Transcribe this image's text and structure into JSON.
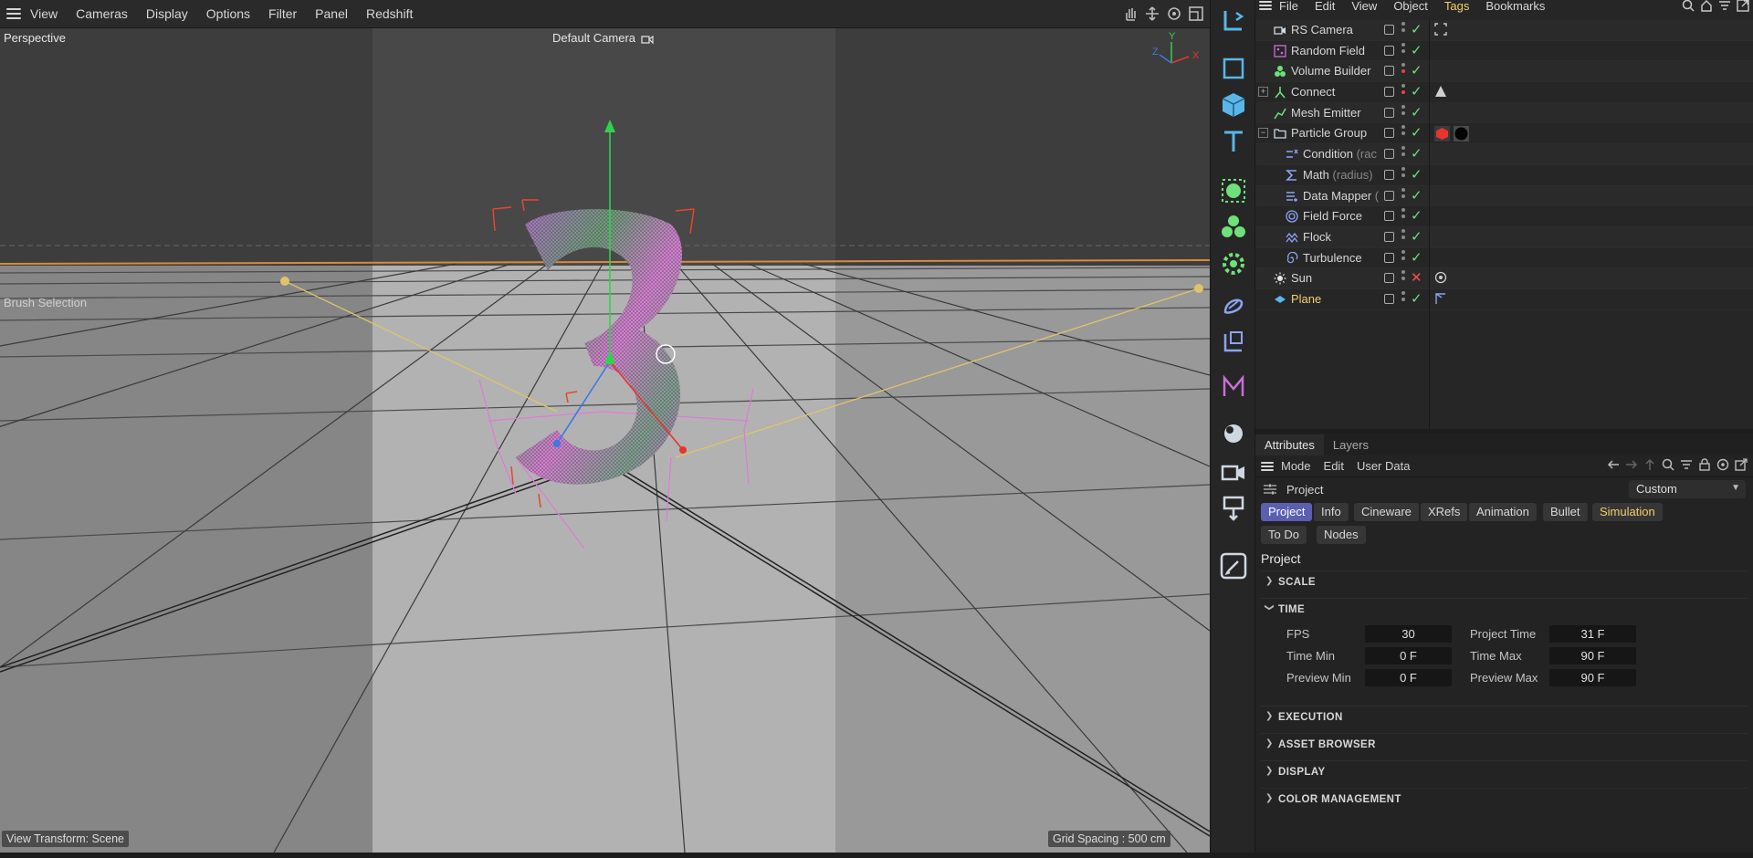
{
  "viewport": {
    "menu": [
      "View",
      "Cameras",
      "Display",
      "Options",
      "Filter",
      "Panel",
      "Redshift"
    ],
    "projection": "Perspective",
    "camera": "Default Camera",
    "mode_label": "Brush Selection",
    "view_transform": "View Transform: Scene",
    "grid_spacing": "Grid Spacing : 500 cm",
    "axis_labels": {
      "x": "X",
      "y": "Y",
      "z": "Z"
    },
    "tools": [
      "hand-icon",
      "move-view-icon",
      "rotate-view-icon",
      "maximize-icon"
    ]
  },
  "palette": {
    "tools": [
      "live-selection-icon",
      "cube-outline-icon",
      "cube-icon",
      "text-icon",
      "spline-gear-icon",
      "cloner-icon",
      "generator-gear-icon",
      "deformer-icon",
      "coordinate-icon",
      "field-icon",
      "light-icon",
      "camera-icon",
      "paint-icon",
      "edit-pen-icon"
    ]
  },
  "object_manager": {
    "menu": [
      "File",
      "Edit",
      "View",
      "Object",
      "Tags",
      "Bookmarks"
    ],
    "active_menu": "Tags",
    "objects": [
      {
        "name": "RS Camera",
        "indent": 1,
        "check": "ok",
        "dots_red": false
      },
      {
        "name": "Random Field",
        "indent": 1,
        "check": "ok",
        "dots_red": false
      },
      {
        "name": "Volume Builder",
        "indent": 1,
        "check": "ok",
        "dots_red": true
      },
      {
        "name": "Connect",
        "indent": 1,
        "check": "ok",
        "dots_red": true,
        "expander": "+"
      },
      {
        "name": "Mesh Emitter",
        "indent": 1,
        "check": "ok",
        "dots_red": false
      },
      {
        "name": "Particle Group",
        "indent": 1,
        "check": "ok",
        "dots_red": false,
        "expander": "−"
      },
      {
        "name": "Condition",
        "dim": "(rac",
        "indent": 2,
        "check": "ok",
        "dots_red": false
      },
      {
        "name": "Math",
        "dim": "(radius)",
        "indent": 2,
        "check": "ok",
        "dots_red": false
      },
      {
        "name": "Data Mapper",
        "dim": "(",
        "indent": 2,
        "check": "ok",
        "dots_red": false
      },
      {
        "name": "Field Force",
        "indent": 2,
        "check": "ok",
        "dots_red": false
      },
      {
        "name": "Flock",
        "indent": 2,
        "check": "ok",
        "dots_red": false
      },
      {
        "name": "Turbulence",
        "indent": 2,
        "check": "ok",
        "dots_red": false
      },
      {
        "name": "Sun",
        "indent": 1,
        "check": "x",
        "dots_red": false
      },
      {
        "name": "Plane",
        "indent": 1,
        "check": "ok",
        "dots_red": false,
        "highlight": true
      }
    ],
    "check_glyph": "✓",
    "x_glyph": "✕"
  },
  "attributes": {
    "tabs": [
      "Attributes",
      "Layers"
    ],
    "menu": [
      "Mode",
      "Edit",
      "User Data"
    ],
    "object_label": "Project",
    "preset": "Custom",
    "chips_row1": [
      "Project",
      "Info",
      "Cineware",
      "XRefs",
      "Animation",
      "Bullet",
      "Simulation"
    ],
    "chips_row2": [
      "To Do",
      "Nodes"
    ],
    "section": "Project",
    "groups": {
      "scale": "SCALE",
      "time": "TIME",
      "execution": "EXECUTION",
      "asset_browser": "ASSET BROWSER",
      "display": "DISPLAY",
      "color_management": "COLOR MANAGEMENT"
    },
    "time": {
      "fps_label": "FPS",
      "fps": "30",
      "project_time_label": "Project Time",
      "project_time": "31 F",
      "time_min_label": "Time Min",
      "time_min": "0 F",
      "time_max_label": "Time Max",
      "time_max": "90 F",
      "preview_min_label": "Preview Min",
      "preview_min": "0 F",
      "preview_max_label": "Preview Max",
      "preview_max": "90 F"
    }
  }
}
